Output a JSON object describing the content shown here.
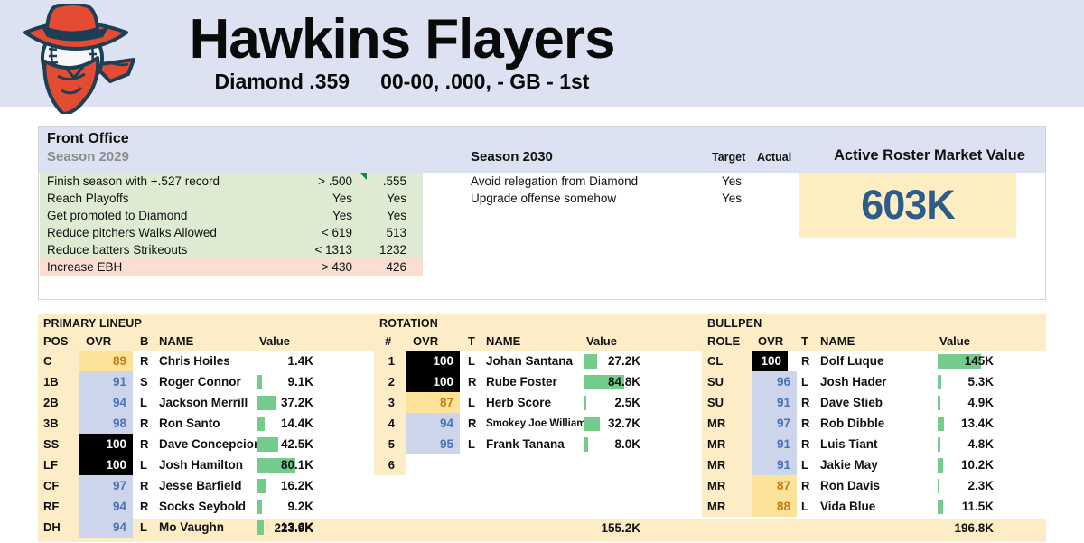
{
  "header": {
    "team_name": "Hawkins Flayers",
    "league": "Diamond .359",
    "record": "00-00, .000, - GB - 1st",
    "logo_name": "baseball-outlaw-logo"
  },
  "front_office": {
    "title": "Front Office",
    "season_past_label": "Season 2029",
    "season_current_label": "Season 2030",
    "target_header": "Target",
    "actual_header": "Actual",
    "market_value_title": "Active Roster Market Value",
    "market_value": "603K",
    "goals_past": [
      {
        "label": "Finish season with +.527 record",
        "target": "> .500",
        "actual": ".555",
        "status": "pass",
        "note_flag": true
      },
      {
        "label": "Reach Playoffs",
        "target": "Yes",
        "actual": "Yes",
        "status": "pass",
        "note_flag": false
      },
      {
        "label": "Get promoted to Diamond",
        "target": "Yes",
        "actual": "Yes",
        "status": "pass",
        "note_flag": false
      },
      {
        "label": "Reduce pitchers Walks Allowed",
        "target": "< 619",
        "actual": "513",
        "status": "pass",
        "note_flag": false
      },
      {
        "label": "Reduce batters Strikeouts",
        "target": "< 1313",
        "actual": "1232",
        "status": "pass",
        "note_flag": false
      },
      {
        "label": "Increase EBH",
        "target": "> 430",
        "actual": "426",
        "status": "fail",
        "note_flag": false
      }
    ],
    "goals_current": [
      {
        "label": "Avoid relegation from Diamond",
        "target": "Yes",
        "actual": ""
      },
      {
        "label": "Upgrade offense somehow",
        "target": "Yes",
        "actual": ""
      }
    ]
  },
  "lineup": {
    "title": "PRIMARY LINEUP",
    "columns": {
      "pos": "POS",
      "ovr": "OVR",
      "hand": "B",
      "name": "NAME",
      "value": "Value"
    },
    "total": "223.9K",
    "rows": [
      {
        "pos": "C",
        "ovr": "89",
        "ovr_tier": "warn",
        "hand": "R",
        "name": "Chris Hoiles",
        "value": "1.4K",
        "bar": 0
      },
      {
        "pos": "1B",
        "ovr": "91",
        "ovr_tier": "good",
        "hand": "S",
        "name": "Roger Connor",
        "value": "9.1K",
        "bar": 5
      },
      {
        "pos": "2B",
        "ovr": "94",
        "ovr_tier": "good",
        "hand": "L",
        "name": "Jackson Merrill",
        "value": "37.2K",
        "bar": 20
      },
      {
        "pos": "3B",
        "ovr": "98",
        "ovr_tier": "good",
        "hand": "R",
        "name": "Ron Santo",
        "value": "14.4K",
        "bar": 8
      },
      {
        "pos": "SS",
        "ovr": "100",
        "ovr_tier": "elite",
        "hand": "R",
        "name": "Dave Concepcion",
        "value": "42.5K",
        "bar": 23
      },
      {
        "pos": "LF",
        "ovr": "100",
        "ovr_tier": "elite",
        "hand": "L",
        "name": "Josh Hamilton",
        "value": "80.1K",
        "bar": 42
      },
      {
        "pos": "CF",
        "ovr": "97",
        "ovr_tier": "good",
        "hand": "R",
        "name": "Jesse Barfield",
        "value": "16.2K",
        "bar": 9
      },
      {
        "pos": "RF",
        "ovr": "94",
        "ovr_tier": "good",
        "hand": "R",
        "name": "Socks Seybold",
        "value": "9.2K",
        "bar": 5
      },
      {
        "pos": "DH",
        "ovr": "94",
        "ovr_tier": "good",
        "hand": "L",
        "name": "Mo Vaughn",
        "value": "13.6K",
        "bar": 7
      }
    ]
  },
  "rotation": {
    "title": "ROTATION",
    "columns": {
      "pos": "#",
      "ovr": "OVR",
      "hand": "T",
      "name": "NAME",
      "value": "Value"
    },
    "total": "155.2K",
    "rows": [
      {
        "pos": "1",
        "ovr": "100",
        "ovr_tier": "elite",
        "hand": "L",
        "name": "Johan Santana",
        "value": "27.2K",
        "bar": 14,
        "small": false
      },
      {
        "pos": "2",
        "ovr": "100",
        "ovr_tier": "elite",
        "hand": "R",
        "name": "Rube Foster",
        "value": "84.8K",
        "bar": 44,
        "small": false
      },
      {
        "pos": "3",
        "ovr": "87",
        "ovr_tier": "warn",
        "hand": "L",
        "name": "Herb Score",
        "value": "2.5K",
        "bar": 2,
        "small": false
      },
      {
        "pos": "4",
        "ovr": "94",
        "ovr_tier": "good",
        "hand": "R",
        "name": "Smokey Joe Williams",
        "value": "32.7K",
        "bar": 17,
        "small": true
      },
      {
        "pos": "5",
        "ovr": "95",
        "ovr_tier": "good",
        "hand": "L",
        "name": "Frank Tanana",
        "value": "8.0K",
        "bar": 4,
        "small": false
      },
      {
        "pos": "6",
        "ovr": "",
        "ovr_tier": "none",
        "hand": "",
        "name": "",
        "value": "",
        "bar": 0,
        "small": false
      }
    ]
  },
  "bullpen": {
    "title": "BULLPEN",
    "columns": {
      "pos": "ROLE",
      "ovr": "OVR",
      "hand": "T",
      "name": "NAME",
      "value": "Value"
    },
    "total": "196.8K",
    "rows": [
      {
        "pos": "CL",
        "ovr": "100",
        "ovr_tier": "elite",
        "hand": "R",
        "name": "Dolf Luque",
        "value": "145K",
        "bar": 48
      },
      {
        "pos": "SU",
        "ovr": "96",
        "ovr_tier": "good",
        "hand": "L",
        "name": "Josh Hader",
        "value": "5.3K",
        "bar": 4
      },
      {
        "pos": "SU",
        "ovr": "91",
        "ovr_tier": "good",
        "hand": "R",
        "name": "Dave Stieb",
        "value": "4.9K",
        "bar": 3
      },
      {
        "pos": "MR",
        "ovr": "97",
        "ovr_tier": "good",
        "hand": "R",
        "name": "Rob Dibble",
        "value": "13.4K",
        "bar": 7
      },
      {
        "pos": "MR",
        "ovr": "91",
        "ovr_tier": "good",
        "hand": "R",
        "name": "Luis Tiant",
        "value": "4.8K",
        "bar": 3
      },
      {
        "pos": "MR",
        "ovr": "91",
        "ovr_tier": "good",
        "hand": "L",
        "name": "Jakie May",
        "value": "10.2K",
        "bar": 6
      },
      {
        "pos": "MR",
        "ovr": "87",
        "ovr_tier": "warn",
        "hand": "R",
        "name": "Ron Davis",
        "value": "2.3K",
        "bar": 2
      },
      {
        "pos": "MR",
        "ovr": "88",
        "ovr_tier": "warn",
        "hand": "L",
        "name": "Vida Blue",
        "value": "11.5K",
        "bar": 6
      }
    ]
  },
  "colors": {
    "header_band": "#dde2f2",
    "cream": "#fdedc7",
    "pass_green": "#dcebd2",
    "fail_red": "#fbded2",
    "bar_green": "#74cc8c",
    "elite_bg": "#000000",
    "good_bg": "#ccd5ea",
    "warn_bg": "#fde29a",
    "market_value_text": "#2e5c8a"
  }
}
